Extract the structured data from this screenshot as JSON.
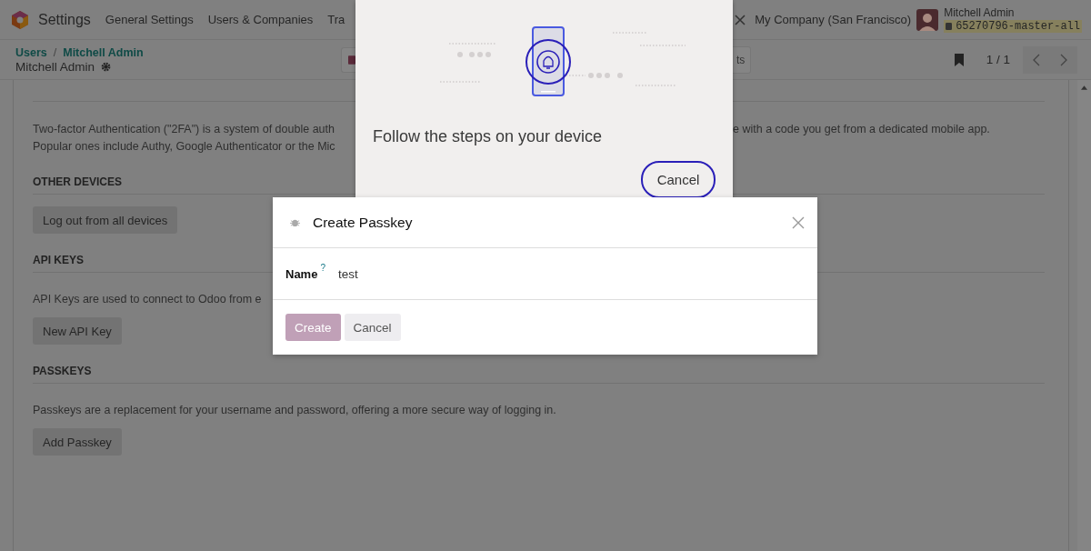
{
  "navbar": {
    "app_name": "Settings",
    "menu": [
      "General Settings",
      "Users & Companies",
      "Tra"
    ],
    "company": "My Company (San Francisco)",
    "user": {
      "name": "Mitchell Admin",
      "database": "65270796-master-all"
    }
  },
  "breadcrumb": {
    "items": [
      "Users",
      "Mitchell Admin"
    ],
    "separator": "/",
    "current": "Mitchell Admin"
  },
  "toolbar": {
    "button_fragment": "ts",
    "pager": "1 / 1"
  },
  "two_factor": {
    "lines": [
      [
        "Two-factor Authentication (\"2FA\") is a system of double auth",
        "e with a code you get from a dedicated mobile app."
      ],
      [
        "Popular ones include Authy, Google Authenticator or the Mic"
      ]
    ]
  },
  "sections": [
    {
      "title": "OTHER DEVICES",
      "button": "Log out from all devices"
    },
    {
      "title": "API KEYS",
      "text": "API Keys are used to connect to Odoo from e",
      "button": "New API Key"
    },
    {
      "title": "PASSKEYS",
      "text": "Passkeys are a replacement for your username and password, offering a more secure way of logging in.",
      "button": "Add Passkey"
    }
  ],
  "dialog": {
    "title": "Create Passkey",
    "field": {
      "label": "Name",
      "help": "?",
      "value": "test"
    },
    "buttons": [
      {
        "label": "Create",
        "kind": "primary"
      },
      {
        "label": "Cancel",
        "kind": "secondary"
      }
    ]
  },
  "device_prompt": {
    "message": "Follow the steps on your device",
    "button": "Cancel"
  }
}
